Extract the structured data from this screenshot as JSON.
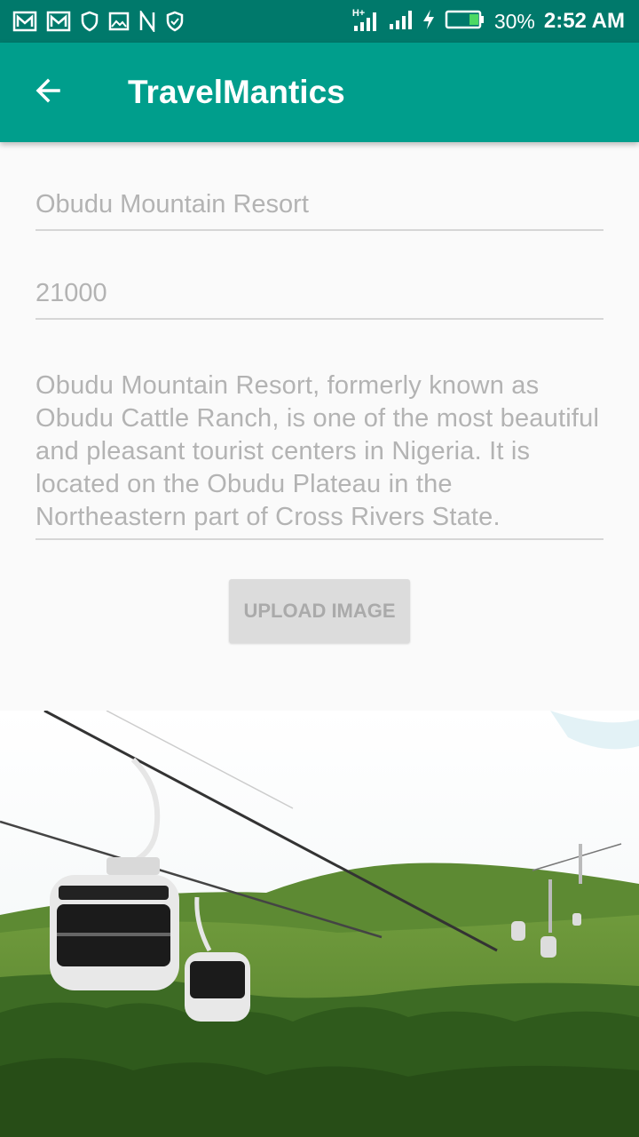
{
  "status_bar": {
    "left_icons": [
      "gmail-icon",
      "gmail-icon",
      "shield-icon",
      "image-icon",
      "n-icon",
      "shield-check-icon"
    ],
    "network_label": "H+",
    "battery_percent": "30%",
    "time": "2:52 AM"
  },
  "app_bar": {
    "back_icon": "arrow-back-icon",
    "title": "TravelMantics"
  },
  "form": {
    "title_value": "Obudu Mountain Resort",
    "price_value": "21000",
    "description_value": "Obudu Mountain Resort, formerly known as Obudu Cattle Ranch, is one of the most beautiful and pleasant tourist centers in Nigeria. It is located on the Obudu Plateau in the Northeastern part of Cross Rivers State.",
    "upload_button": "UPLOAD IMAGE"
  },
  "colors": {
    "status_bar": "#00796b",
    "app_bar": "#009e8c",
    "field_text": "#b3b3b3"
  }
}
